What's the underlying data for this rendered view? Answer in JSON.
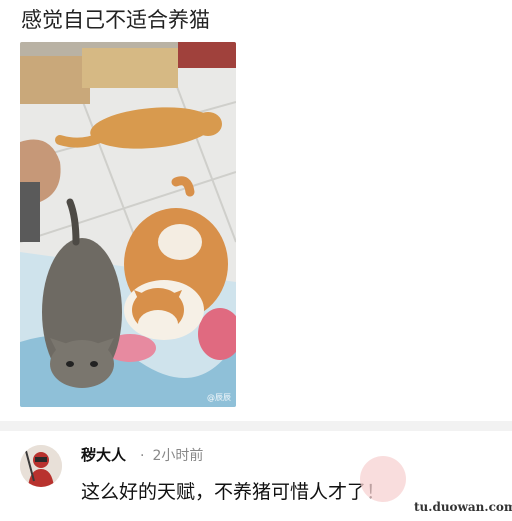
{
  "post": {
    "title": "感觉自己不适合养猫",
    "photo_watermark": "@辰辰"
  },
  "comment": {
    "username": "秽大人",
    "time_separator": "·",
    "time": "2小时前",
    "text": "这么好的天赋，不养猪可惜人才了！",
    "avatar_icon": "user-avatar"
  },
  "site_watermark": "tu.duowan.com",
  "colors": {
    "username": "#111111",
    "meta": "#888888",
    "divider": "#f2f2f2"
  }
}
